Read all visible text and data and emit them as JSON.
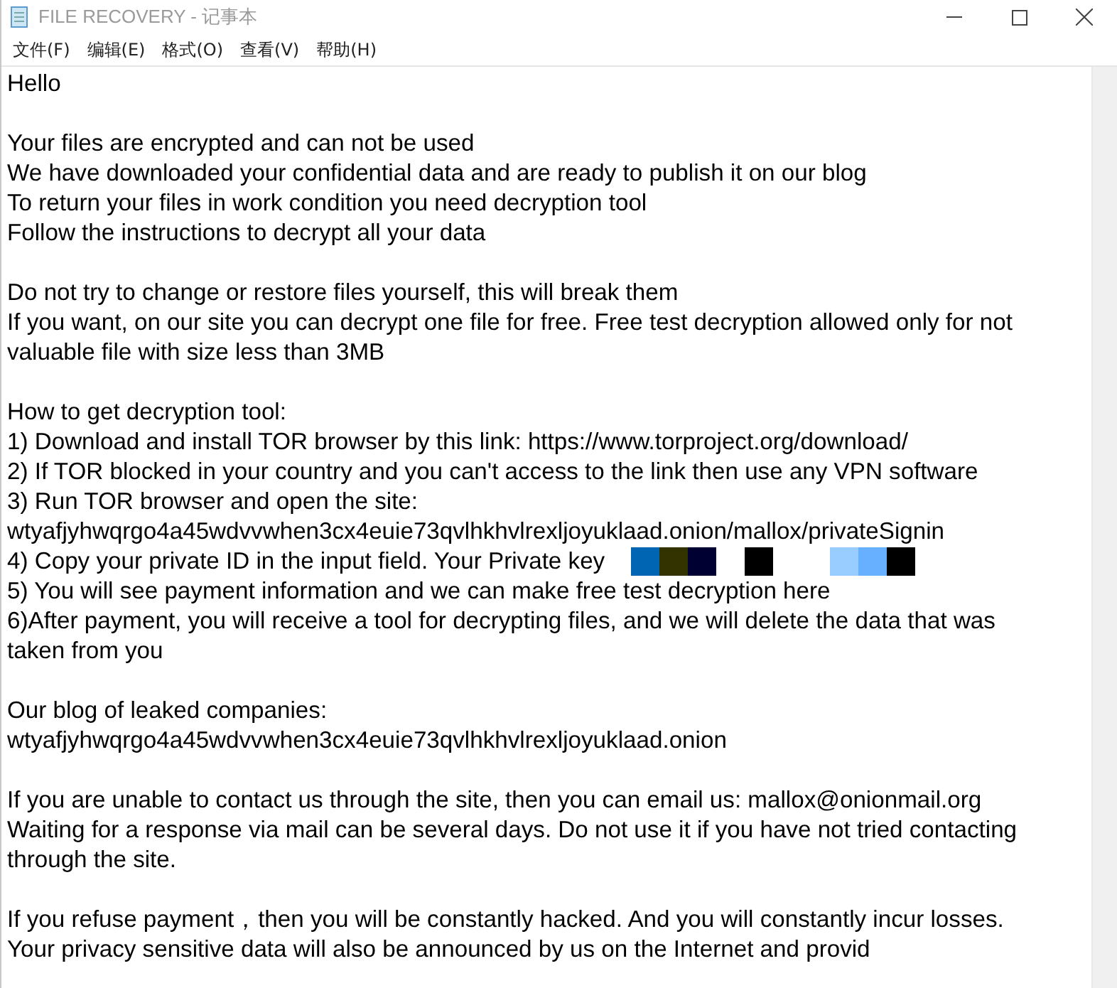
{
  "window": {
    "title": "FILE RECOVERY - 记事本"
  },
  "menu": [
    "文件(F)",
    "编辑(E)",
    "格式(O)",
    "查看(V)",
    "帮助(H)"
  ],
  "paragraphs": [
    {
      "lines": [
        {
          "text": "Hello"
        }
      ]
    },
    {
      "lines": [
        {
          "text": "Your files are encrypted and can not be used"
        },
        {
          "text": "We have downloaded your confidential data and are ready to publish it on our blog"
        },
        {
          "text": "To return your files in work condition you need decryption tool"
        },
        {
          "text": "Follow the instructions to decrypt all your data"
        }
      ]
    },
    {
      "lines": [
        {
          "text": "Do not try to change or restore files yourself, this will break them"
        },
        {
          "text": "If you want, on our site you can decrypt one file for free. Free test decryption allowed only for not"
        },
        {
          "text": "valuable file with size less than 3MB"
        }
      ]
    },
    {
      "lines": [
        {
          "text": "How to get decryption tool:"
        },
        {
          "text": "1) Download and install TOR browser by this link: https://www.torproject.org/download/"
        },
        {
          "text": "2) If TOR blocked in your country and you can't access to the link then use any VPN software"
        },
        {
          "text": "3) Run TOR browser and open the site:"
        },
        {
          "text": "wtyafjyhwqrgo4a45wdvvwhen3cx4euie73qvlhkhvlrexljoyuklaad.onion/mallox/privateSignin"
        },
        {
          "text": "4) Copy your private ID in the input field. Your Private key",
          "redacted": true
        },
        {
          "text": "5) You will see payment information and we can make free test decryption here"
        },
        {
          "text": "6)After payment, you will receive a tool for decrypting files, and we will delete the data that was"
        },
        {
          "text": "taken from you"
        }
      ]
    },
    {
      "lines": [
        {
          "text": "Our blog of leaked companies:"
        },
        {
          "text": "wtyafjyhwqrgo4a45wdvvwhen3cx4euie73qvlhkhvlrexljoyuklaad.onion"
        }
      ]
    },
    {
      "lines": [
        {
          "text": "If you are unable to contact us through the site, then you can email us: mallox@onionmail.org"
        },
        {
          "text": "Waiting for a response via mail can be several days. Do not use it if you have not tried contacting"
        },
        {
          "text": "through the site."
        }
      ]
    },
    {
      "lines": [
        {
          "text": "If you refuse payment，then you will be constantly hacked. And you will constantly incur losses."
        },
        {
          "text": "Your privacy sensitive data will also be announced by us on the Internet and provid"
        }
      ]
    }
  ]
}
